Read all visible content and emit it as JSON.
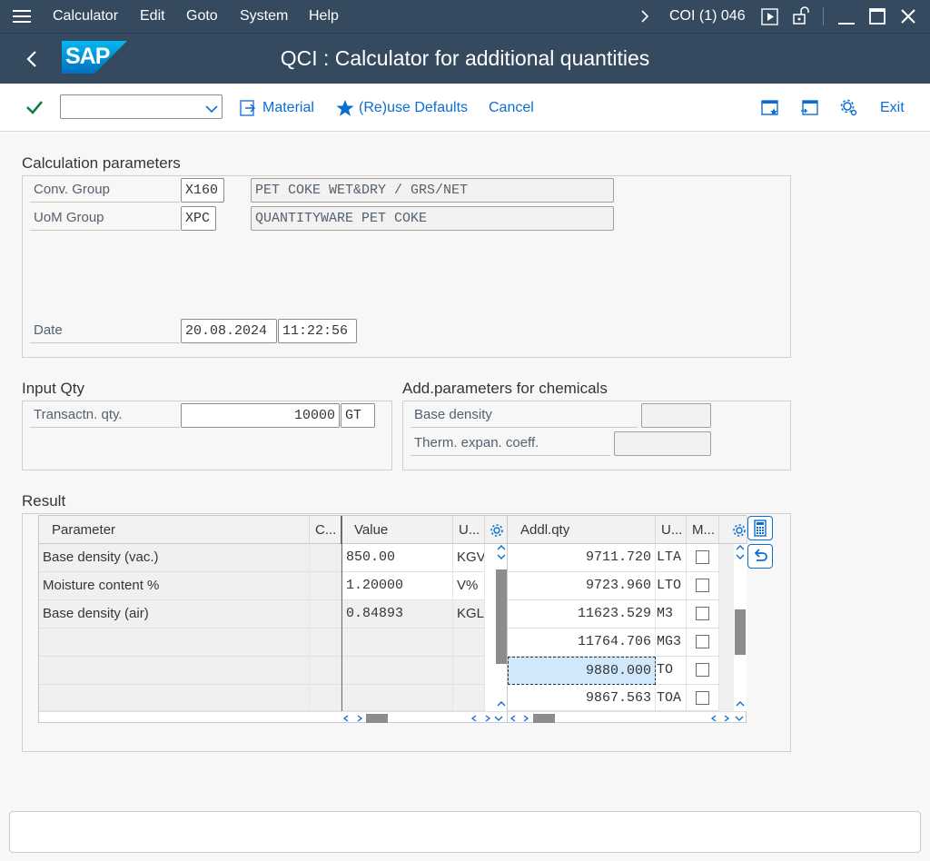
{
  "menu": {
    "items": [
      "Calculator",
      "Edit",
      "Goto",
      "System",
      "Help"
    ],
    "session": "COI (1) 046"
  },
  "header": {
    "title": "QCI : Calculator for additional quantities",
    "logo": "SAP"
  },
  "toolbar": {
    "command_field": "",
    "material": "Material",
    "reuse_defaults": "(Re)use Defaults",
    "cancel": "Cancel",
    "exit": "Exit"
  },
  "calc_params": {
    "title": "Calculation parameters",
    "conv_group_label": "Conv. Group",
    "conv_group_value": "X160",
    "conv_group_desc": "PET COKE WET&DRY / GRS/NET",
    "uom_group_label": "UoM Group",
    "uom_group_value": "XPC",
    "uom_group_desc": "QUANTITYWARE PET COKE",
    "date_label": "Date",
    "date_value": "20.08.2024",
    "time_value": "11:22:56"
  },
  "input_qty": {
    "title": "Input Qty",
    "trans_label": "Transactn. qty.",
    "trans_value": "10000",
    "trans_unit": "GT"
  },
  "chem": {
    "title": "Add.parameters for chemicals",
    "base_density_label": "Base density",
    "base_density_value": "",
    "therm_label": "Therm. expan. coeff.",
    "therm_value": ""
  },
  "result": {
    "title": "Result",
    "left_headers": {
      "parameter": "Parameter",
      "c": "C...",
      "value": "Value",
      "u": "U..."
    },
    "left_rows": [
      {
        "parameter": "Base density (vac.)",
        "c": "",
        "value": "850.00",
        "unit": "KGV"
      },
      {
        "parameter": "Moisture content %",
        "c": "",
        "value": "1.20000",
        "unit": "V%"
      },
      {
        "parameter": "Base density (air)",
        "c": "",
        "value": "0.84893",
        "unit": "KGL"
      }
    ],
    "right_headers": {
      "qty": "Addl.qty",
      "u": "U...",
      "m": "M..."
    },
    "right_rows": [
      {
        "qty": "9711.720",
        "unit": "LTA"
      },
      {
        "qty": "9723.960",
        "unit": "LTO"
      },
      {
        "qty": "11623.529",
        "unit": "M3"
      },
      {
        "qty": "11764.706",
        "unit": "MG3"
      },
      {
        "qty": "9880.000",
        "unit": "TO"
      },
      {
        "qty": "9867.563",
        "unit": "TOA"
      }
    ]
  },
  "status": {
    "text": ""
  }
}
